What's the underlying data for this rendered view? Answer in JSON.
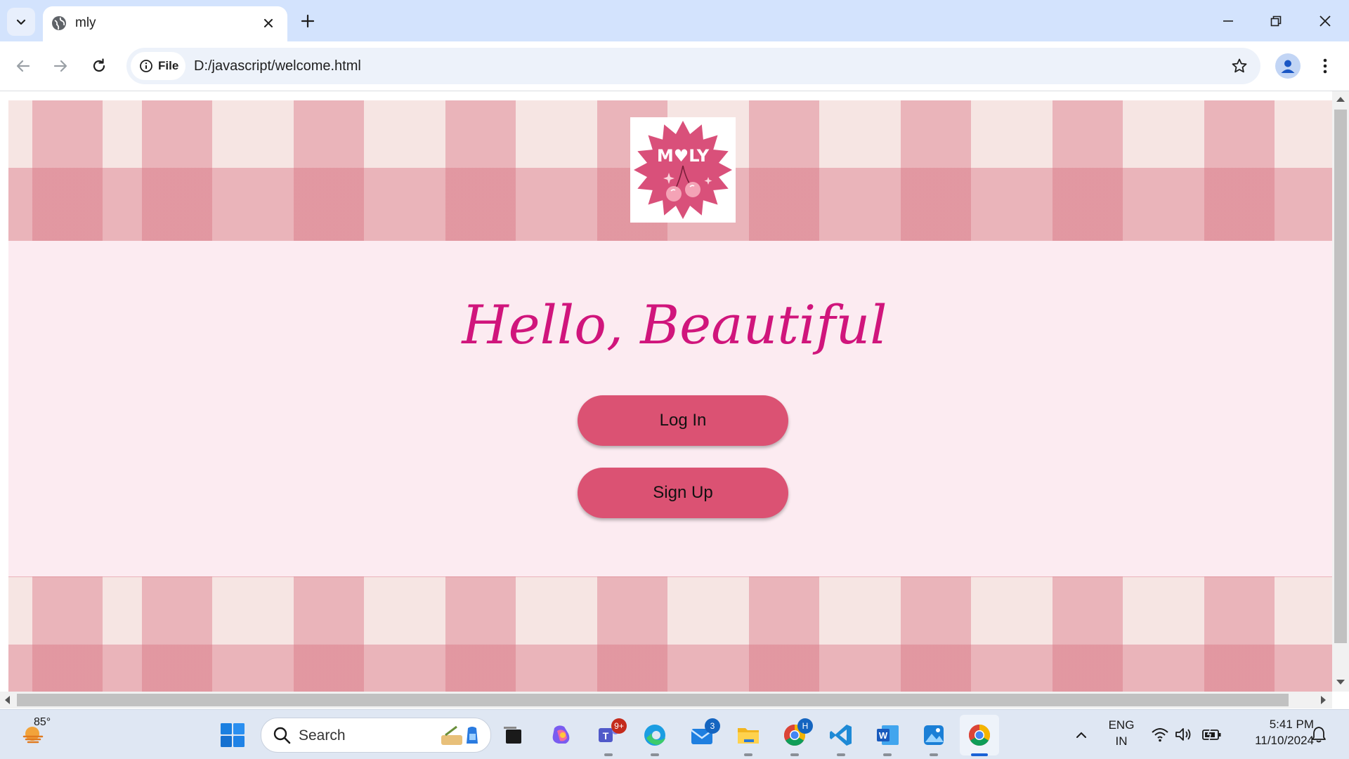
{
  "browser": {
    "tab": {
      "title": "mly"
    },
    "omnibox": {
      "site_info_label": "File",
      "url": "D:/javascript/welcome.html"
    }
  },
  "page": {
    "logo_text": "M♥LY",
    "greeting": "Hello, Beautiful",
    "login_label": "Log In",
    "signup_label": "Sign Up",
    "colors": {
      "background": "#fcebf1",
      "greeting": "#d0157c",
      "button": "#db5273",
      "gingham": "#d66c7c"
    }
  },
  "taskbar": {
    "weather_temp": "85°",
    "search_placeholder": "Search",
    "teams_badge": "9+",
    "outlook_badge": "3",
    "chrome_profile_badge": "H",
    "language": "ENG",
    "region": "IN",
    "time": "5:41 PM",
    "date": "11/10/2024"
  }
}
